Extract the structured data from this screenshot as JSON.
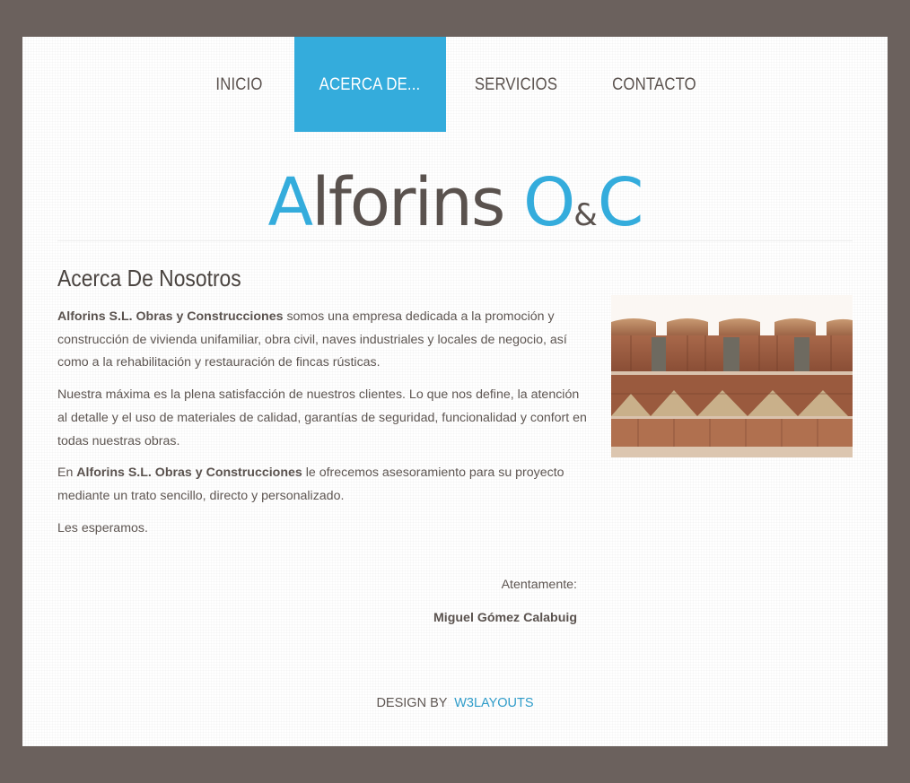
{
  "nav": {
    "items": [
      {
        "label": "INICIO"
      },
      {
        "label": "ACERCA DE..."
      },
      {
        "label": "SERVICIOS"
      },
      {
        "label": "CONTACTO"
      }
    ],
    "active_index": 1
  },
  "logo": {
    "part1_blue": "A",
    "part2": "lforins ",
    "part3_blue": "O",
    "part4_amp": "&",
    "part5_blue": "C"
  },
  "about": {
    "title": "Acerca De Nosotros",
    "p1_bold": "Alforins S.L. Obras y Construcciones",
    "p1_rest": " somos una empresa dedicada a la promoción y construcción de vivienda unifamiliar, obra civil, naves industriales y locales de negocio, así como a la rehabilitación y restauración de fincas rústicas.",
    "p2": "Nuestra máxima es la plena satisfacción de nuestros clientes. Lo que nos define, la atención al detalle y el uso de materiales de calidad, garantías de seguridad, funcionalidad y confort en todas nuestras obras.",
    "p3_pre": "En ",
    "p3_bold": "Alforins S.L. Obras y Construcciones",
    "p3_rest": " le ofrecemos asesoramiento para su proyecto mediante un trato sencillo, directo y personalizado.",
    "p4": "Les esperamos.",
    "closing": "Atentamente:",
    "signature": "Miguel Gómez Calabuig"
  },
  "footer": {
    "design_by": "DESIGN BY",
    "link": "W3LAYOUTS"
  },
  "colors": {
    "accent": "#34acdc",
    "frame": "#6b615d",
    "text": "#5e5652"
  }
}
